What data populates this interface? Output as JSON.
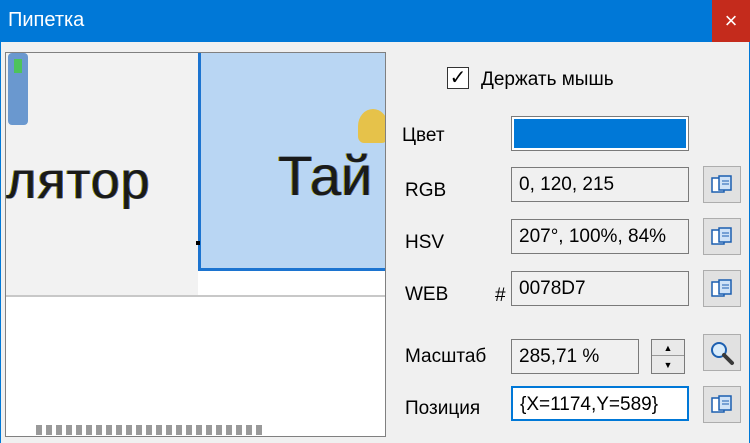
{
  "window": {
    "title": "Пипетка",
    "close_glyph": "×"
  },
  "preview": {
    "text_left": "лятор",
    "text_right": "Тай"
  },
  "hold_mouse": {
    "label": "Держать мышь",
    "checked": true,
    "check_glyph": "✓"
  },
  "color": {
    "label": "Цвет",
    "hex": "#0078D7"
  },
  "rgb": {
    "label": "RGB",
    "value": "0, 120, 215"
  },
  "hsv": {
    "label": "HSV",
    "value": "207°, 100%, 84%"
  },
  "web": {
    "label": "WEB",
    "hash": "#",
    "value": "0078D7"
  },
  "scale": {
    "label": "Масштаб",
    "value": "285,71 %",
    "up_glyph": "▲",
    "down_glyph": "▼"
  },
  "position": {
    "label": "Позиция",
    "value": "{X=1174,Y=589}"
  },
  "icons": {
    "copy": "copy-icon",
    "zoom": "magnifier-icon"
  },
  "colors": {
    "accent": "#0078D7",
    "close": "#C42B1C"
  }
}
